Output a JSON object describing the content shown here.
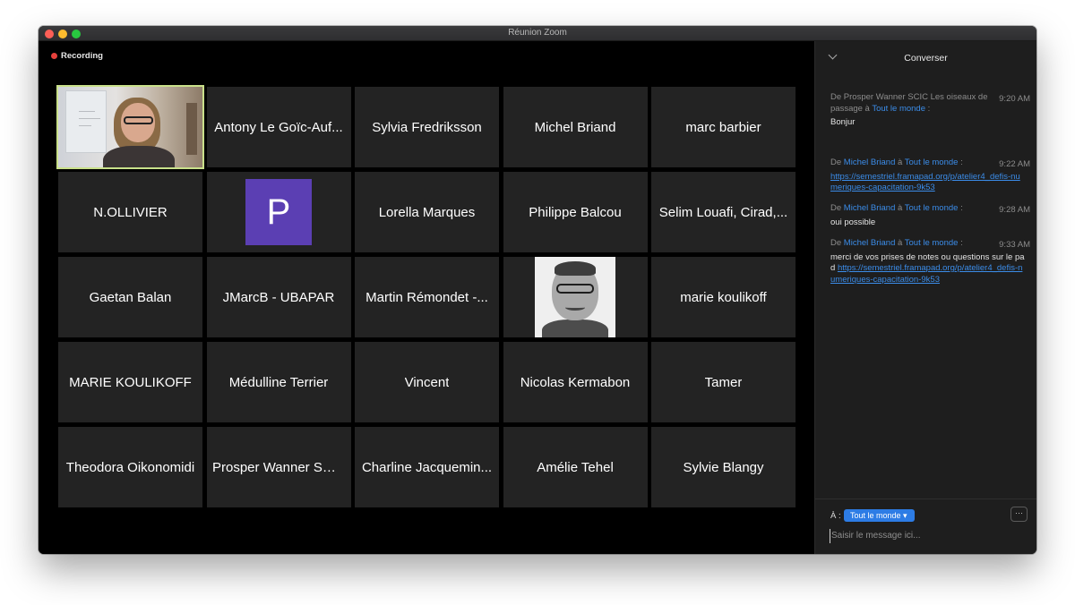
{
  "window": {
    "title": "Réunion Zoom"
  },
  "recording": {
    "label": "Recording",
    "color": "#e5403b"
  },
  "participants": [
    {
      "name": "",
      "type": "video"
    },
    {
      "name": "Antony Le Goïc-Auf..."
    },
    {
      "name": "Sylvia Fredriksson"
    },
    {
      "name": "Michel Briand"
    },
    {
      "name": "marc barbier"
    },
    {
      "name": "N.OLLIVIER"
    },
    {
      "name": "",
      "type": "avatar",
      "initial": "P",
      "color": "#5b3fb3"
    },
    {
      "name": "Lorella Marques"
    },
    {
      "name": "Philippe Balcou"
    },
    {
      "name": "Selim Louafi, Cirad,..."
    },
    {
      "name": "Gaetan Balan"
    },
    {
      "name": "JMarcB - UBAPAR"
    },
    {
      "name": "Martin Rémondet -..."
    },
    {
      "name": "",
      "type": "photo"
    },
    {
      "name": "marie koulikoff"
    },
    {
      "name": "MARIE KOULIKOFF"
    },
    {
      "name": "Médulline Terrier"
    },
    {
      "name": "Vincent"
    },
    {
      "name": "Nicolas Kermabon"
    },
    {
      "name": "Tamer"
    },
    {
      "name": "Theodora Oikonomidi"
    },
    {
      "name": "Prosper Wanner SCI..."
    },
    {
      "name": "Charline Jacquemin..."
    },
    {
      "name": "Amélie Tehel"
    },
    {
      "name": "Sylvie Blangy"
    }
  ],
  "chat": {
    "title": "Converser",
    "messages": [
      {
        "prefix": "De ",
        "sender": "Prosper Wanner SCIC Les oiseaux de passage",
        "mid": " à ",
        "to": "Tout le monde",
        "suffix": " :",
        "time": "9:20 AM",
        "text": "Bonjur",
        "link": ""
      },
      {
        "prefix": "De ",
        "sender": "Michel Briand",
        "mid": " à ",
        "to": "Tout le monde",
        "suffix": " :",
        "time": "9:22 AM",
        "text": "",
        "link": "https://semestriel.framapad.org/p/atelier4_defis-numeriques-capacitation-9k53"
      },
      {
        "prefix": "De ",
        "sender": "Michel Briand",
        "mid": " à ",
        "to": "Tout le monde",
        "suffix": " :",
        "time": "9:28 AM",
        "text": "oui possible",
        "link": ""
      },
      {
        "prefix": "De ",
        "sender": "Michel Briand",
        "mid": " à ",
        "to": "Tout le monde",
        "suffix": " :",
        "time": "9:33 AM",
        "text": "merci de vos prises de notes ou questions sur le pad ",
        "link": "https://semestriel.framapad.org/p/atelier4_defis-numeriques-capacitation-9k53"
      }
    ],
    "composer": {
      "to_label": "À :",
      "recipient": "Tout le monde",
      "more_label": "···",
      "placeholder": "Saisir le message ici..."
    },
    "colors": {
      "link": "#3b8ce8",
      "pill": "#2d7ce5"
    }
  }
}
